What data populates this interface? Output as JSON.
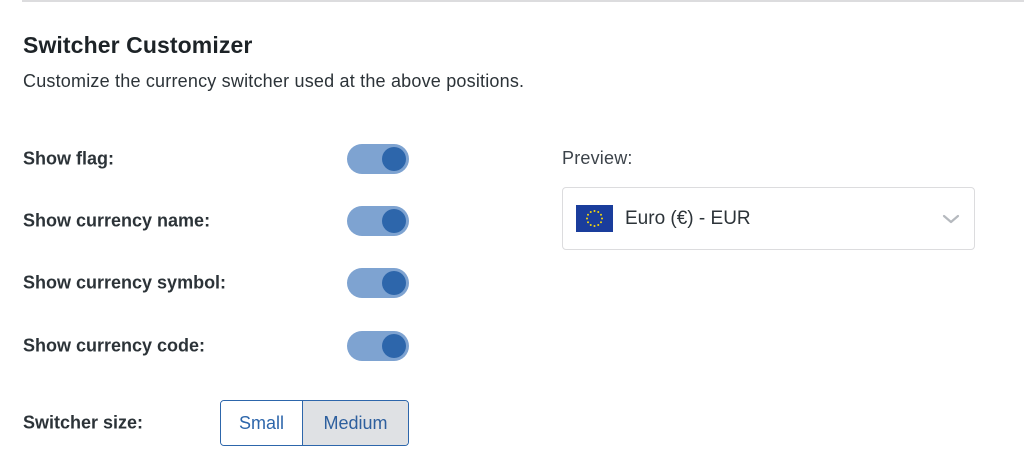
{
  "section": {
    "title": "Switcher Customizer",
    "description": "Customize the currency switcher used at the above positions."
  },
  "options": [
    {
      "label": "Show flag:",
      "enabled": true
    },
    {
      "label": "Show currency name:",
      "enabled": true
    },
    {
      "label": "Show currency symbol:",
      "enabled": true
    },
    {
      "label": "Show currency code:",
      "enabled": true
    }
  ],
  "switcher_size": {
    "label": "Switcher size:",
    "options": [
      "Small",
      "Medium"
    ],
    "selected": "Medium"
  },
  "preview": {
    "label": "Preview:",
    "selected_currency": "Euro (€) - EUR",
    "flag_icon": "eu-flag-icon"
  },
  "colors": {
    "accent": "#2d66ab",
    "toggle_track": "#7ea3d1"
  }
}
